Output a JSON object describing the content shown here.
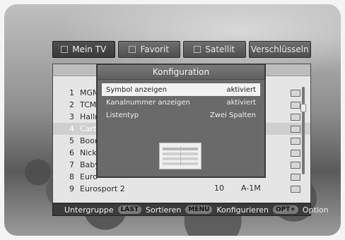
{
  "tabs": [
    {
      "label": "Mein TV"
    },
    {
      "label": "Favorit"
    },
    {
      "label": "Satellit"
    },
    {
      "label": "Verschlüsseln"
    }
  ],
  "channels": [
    {
      "num": "1",
      "name": "MGM"
    },
    {
      "num": "2",
      "name": "TCM"
    },
    {
      "num": "3",
      "name": "Hallr"
    },
    {
      "num": "4",
      "name": "Cart",
      "selected": true
    },
    {
      "num": "5",
      "name": "Boor"
    },
    {
      "num": "6",
      "name": "Nick"
    },
    {
      "num": "7",
      "name": "Baby"
    },
    {
      "num": "8",
      "name": "Euro"
    },
    {
      "num": "9",
      "name": "Eurosport 2",
      "col3": "10",
      "col4": "A-1M"
    }
  ],
  "dialog": {
    "title": "Konfiguration",
    "options": [
      {
        "label": "Symbol anzeigen",
        "value": "aktiviert"
      },
      {
        "label": "Kanalnummer anzeigen",
        "value": "aktiviert"
      },
      {
        "label": "Listentyp",
        "value": "Zwei Spalten"
      }
    ]
  },
  "bottom_bar": {
    "items": [
      {
        "key": "",
        "label": "Untergruppe"
      },
      {
        "key": "LAST",
        "label": "Sortieren"
      },
      {
        "key": "MENU",
        "label": "Konfigurieren"
      },
      {
        "key": "OPT+",
        "label": "Option"
      }
    ]
  },
  "colors": {
    "selected_row": "#cfcfcf",
    "dialog_bg": "#6a6a6a"
  }
}
